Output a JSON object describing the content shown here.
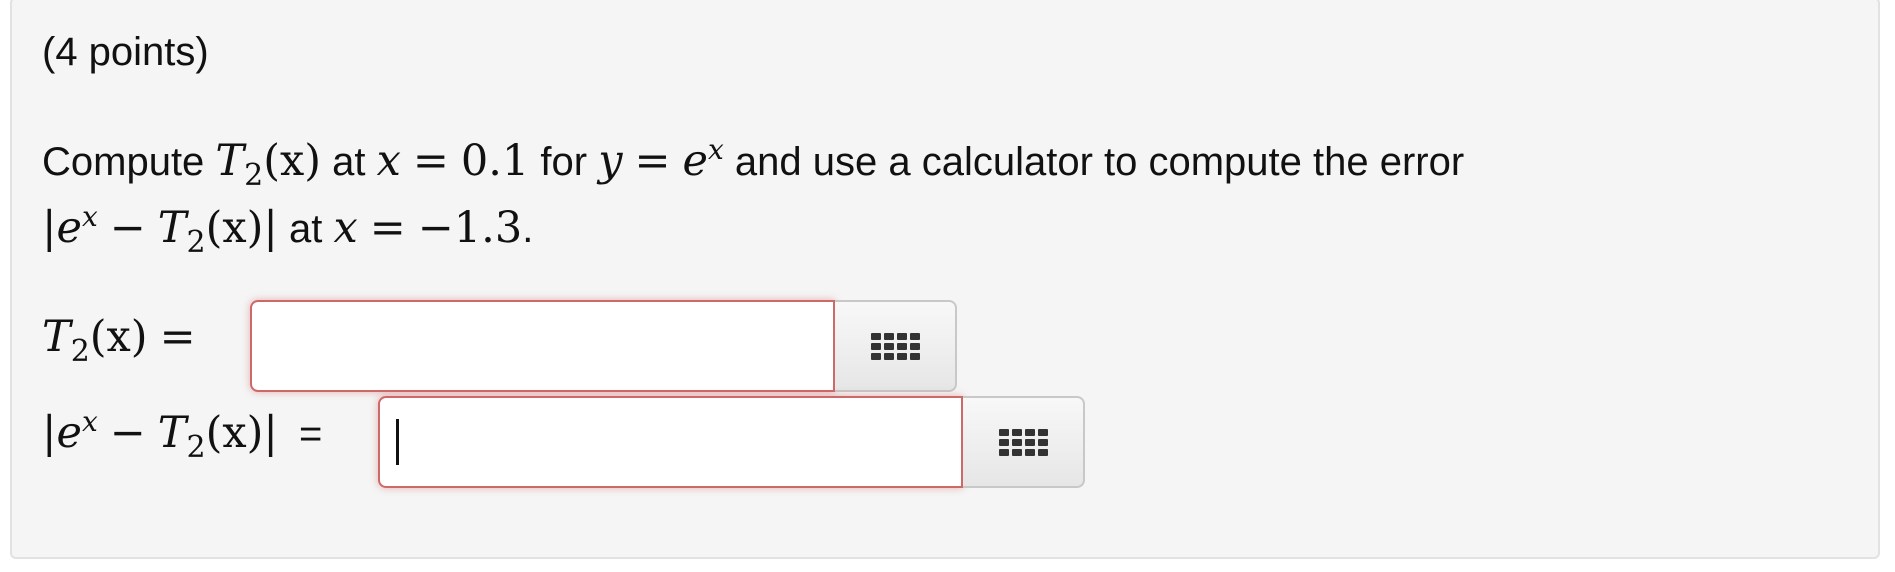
{
  "question": {
    "points": "(4 points)",
    "line1": {
      "t1": "Compute ",
      "m_T": "T",
      "m_sub": "2",
      "m_arg": "(x)",
      "t2": " at ",
      "m_x": "x",
      "m_eq": "=",
      "m_val": "0.1",
      "t3": " for ",
      "m_y": "y",
      "m_eq2": "=",
      "m_e": "e",
      "m_sup": "x",
      "t4": " and use a calculator to compute the error"
    },
    "line2": {
      "m_abs_open": "|",
      "m_e": "e",
      "m_sup": "x",
      "m_minus": "−",
      "m_T": "T",
      "m_sub": "2",
      "m_arg": "(x)",
      "m_abs_close": "|",
      "t1": " at ",
      "m_x": "x",
      "m_eq": "=",
      "m_val": "−1.3",
      "t2": "."
    }
  },
  "answers": {
    "t2": {
      "label_T": "T",
      "label_sub": "2",
      "label_arg": "(x)",
      "label_eq": "=",
      "value": ""
    },
    "error": {
      "label_abs_open": "|",
      "label_e": "e",
      "label_sup": "x",
      "label_minus": "−",
      "label_T": "T",
      "label_sub": "2",
      "label_arg": "(x)",
      "label_abs_close": "|",
      "label_eq": "=",
      "value": ""
    }
  },
  "icons": {
    "keypad": "keypad-grid-icon"
  },
  "colors": {
    "panel_bg": "#f5f5f5",
    "error_border": "#cc6a6a"
  }
}
